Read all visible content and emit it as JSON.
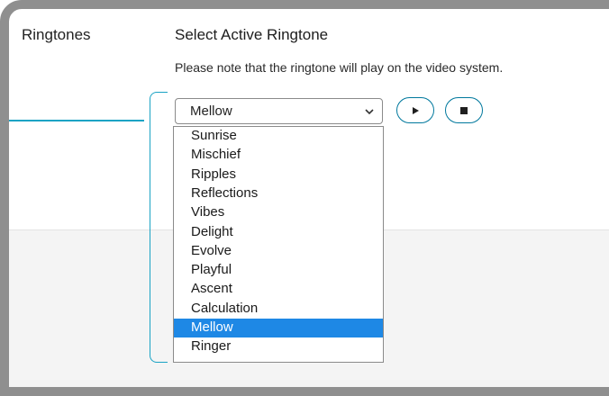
{
  "sidebar": {
    "label": "Ringtones"
  },
  "section": {
    "title": "Select Active Ringtone",
    "note": "Please note that the ringtone will play on the video system."
  },
  "ringtone_select": {
    "value": "Mellow",
    "options": [
      "Sunrise",
      "Mischief",
      "Ripples",
      "Reflections",
      "Vibes",
      "Delight",
      "Evolve",
      "Playful",
      "Ascent",
      "Calculation",
      "Mellow",
      "Ringer"
    ],
    "selected_index": 10
  },
  "controls": {
    "play_icon": "play-icon",
    "stop_icon": "stop-icon"
  },
  "colors": {
    "accent": "#00789d",
    "callout": "#1aa3c4",
    "selected_highlight": "#1e88e5",
    "frame": "#8f8f8f"
  }
}
